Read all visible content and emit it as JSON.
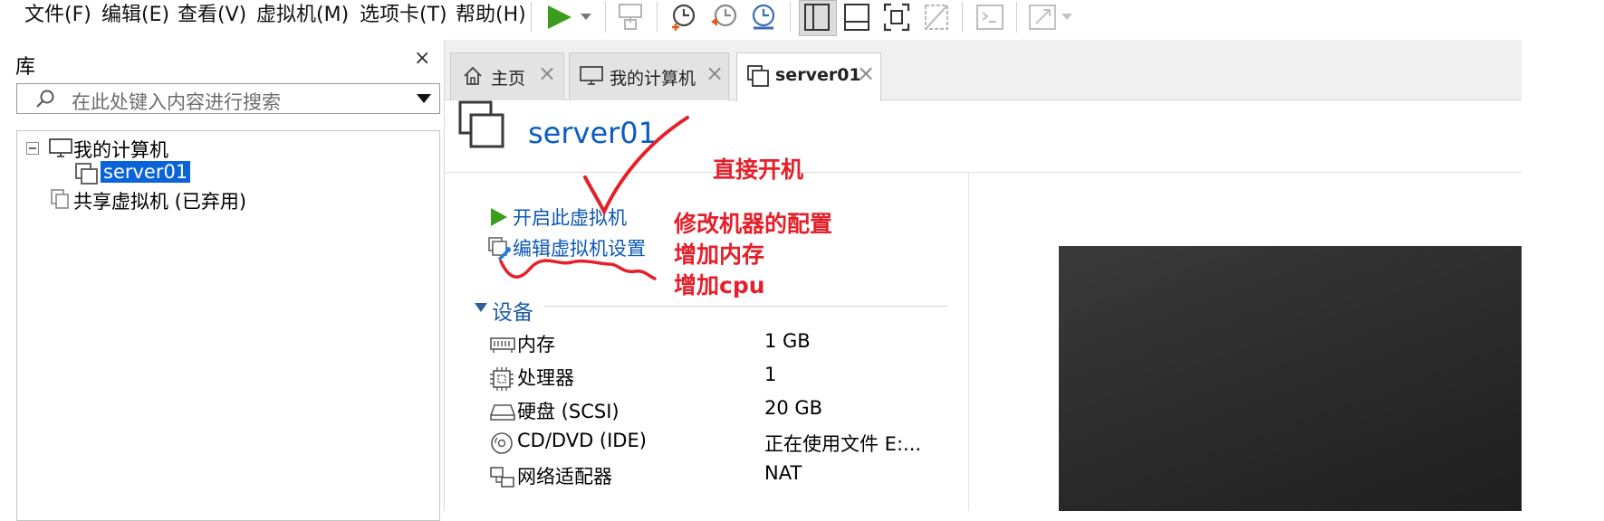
{
  "menubar": {
    "items": [
      "文件(F)",
      "编辑(E)",
      "查看(V)",
      "虚拟机(M)",
      "选项卡(T)",
      "帮助(H)"
    ]
  },
  "library": {
    "title": "库",
    "close": "×",
    "search_placeholder": "在此处键入内容进行搜索",
    "tree": {
      "my_computer": "我的计算机",
      "server": "server01",
      "shared": "共享虚拟机 (已弃用)"
    }
  },
  "tabs": [
    {
      "label": "主页",
      "close": "×"
    },
    {
      "label": "我的计算机",
      "close": "×"
    },
    {
      "label": "server01",
      "close": "×"
    }
  ],
  "vm": {
    "title": "server01",
    "power_on": "开启此虚拟机",
    "edit_settings": "编辑虚拟机设置",
    "devices_header": "设备",
    "devices": [
      {
        "name": "内存",
        "value": "1 GB",
        "icon": "memory-icon"
      },
      {
        "name": "处理器",
        "value": "1",
        "icon": "cpu-icon"
      },
      {
        "name": "硬盘 (SCSI)",
        "value": "20 GB",
        "icon": "hdd-icon"
      },
      {
        "name": "CD/DVD (IDE)",
        "value": "正在使用文件 E:...",
        "icon": "cd-icon"
      },
      {
        "name": "网络适配器",
        "value": "NAT",
        "icon": "network-icon"
      }
    ]
  },
  "annotations": {
    "note1": "直接开机",
    "note2": "修改机器的配置",
    "note3": "增加内存",
    "note4": "增加cpu"
  },
  "colors": {
    "accent": "#0b57b8",
    "play": "#3a9d1e",
    "annotation": "#e5202a",
    "selection": "#0a64d8"
  }
}
